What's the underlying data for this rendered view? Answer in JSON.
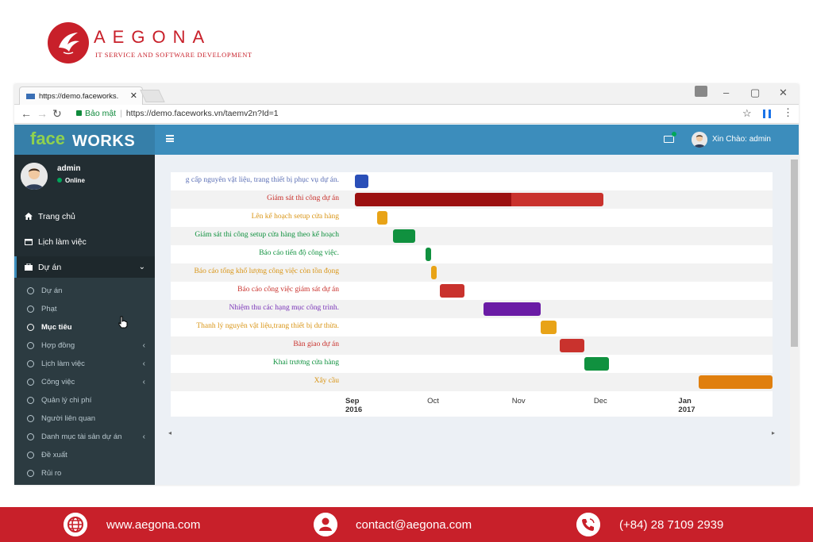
{
  "brand": {
    "name": "AEGONA",
    "tagline": "IT SERVICE AND SOFTWARE DEVELOPMENT"
  },
  "browser": {
    "tab_title": "https://demo.faceworks.",
    "secure_label": "Bảo mật",
    "url": "https://demo.faceworks.vn/taemv2n?Id=1"
  },
  "app": {
    "logo_face": "face",
    "logo_works": "WORKS",
    "user": {
      "name": "admin",
      "status": "Online"
    },
    "greeting": "Xin Chào: admin",
    "menu": [
      {
        "label": "Trang chủ",
        "icon": "home-icon"
      },
      {
        "label": "Lịch làm việc",
        "icon": "calendar-icon"
      },
      {
        "label": "Dự án",
        "icon": "briefcase-icon"
      }
    ],
    "submenu": [
      {
        "label": "Dự án",
        "chevron": false,
        "bold": false
      },
      {
        "label": "Phạt",
        "chevron": false,
        "bold": false
      },
      {
        "label": "Mục tiêu",
        "chevron": false,
        "bold": true
      },
      {
        "label": "Hợp đồng",
        "chevron": true,
        "bold": false
      },
      {
        "label": "Lịch làm việc",
        "chevron": true,
        "bold": false
      },
      {
        "label": "Công việc",
        "chevron": true,
        "bold": false
      },
      {
        "label": "Quản lý chi phí",
        "chevron": false,
        "bold": false
      },
      {
        "label": "Người liên quan",
        "chevron": false,
        "bold": false
      },
      {
        "label": "Danh mục tài sản dự án",
        "chevron": true,
        "bold": false
      },
      {
        "label": "Đề xuất",
        "chevron": false,
        "bold": false
      },
      {
        "label": "Rủi ro",
        "chevron": false,
        "bold": false
      }
    ]
  },
  "gantt": {
    "tasks": [
      {
        "label": "g cấp nguyên vật liệu, trang thiết bị phục vụ dự án.",
        "color": "#2a4fb8",
        "start": "2016-09-01",
        "end": "2016-09-06"
      },
      {
        "label": "Giám sát thi công dự án",
        "color": "#c9322d",
        "done_color": "#9b1010",
        "start": "2016-09-01",
        "end": "2016-12-01",
        "progress": 0.63
      },
      {
        "label": "Lên kế hoạch setup cửa hàng",
        "color": "#e8a317",
        "start": "2016-09-09",
        "end": "2016-09-13"
      },
      {
        "label": "Giám sát thi công setup cửa hàng theo kế hoạch",
        "color": "#10913f",
        "start": "2016-09-15",
        "end": "2016-09-23"
      },
      {
        "label": "Báo cáo tiến độ công việc.",
        "color": "#10913f",
        "start": "2016-09-27",
        "end": "2016-09-29"
      },
      {
        "label": "Báo cáo tổng khổ lượng công việc còn tồn đọng",
        "color": "#e8a317",
        "start": "2016-09-29",
        "end": "2016-10-01"
      },
      {
        "label": "Báo cáo công việc giám sát dự án",
        "color": "#c9322d",
        "start": "2016-10-02",
        "end": "2016-10-11"
      },
      {
        "label": "Nhiệm thu các hạng mục công trình.",
        "color": "#6a1ba5",
        "start": "2016-10-18",
        "end": "2016-11-08"
      },
      {
        "label": "Thanh lý nguyên vật liệu,trang thiết bị dư thừa.",
        "color": "#e8a317",
        "start": "2016-11-08",
        "end": "2016-11-14"
      },
      {
        "label": "Bàn giao dự án",
        "color": "#c9322d",
        "start": "2016-11-15",
        "end": "2016-11-24"
      },
      {
        "label": "Khai trương cửa hàng",
        "color": "#10913f",
        "start": "2016-11-24",
        "end": "2016-12-03"
      },
      {
        "label": "Xây cầu",
        "color": "#e07f0e",
        "start": "2017-01-05",
        "end": "2017-02-01"
      }
    ],
    "ticks": [
      {
        "month": "Sep",
        "year": "2016",
        "date": "2016-09-01"
      },
      {
        "month": "Oct",
        "year": "",
        "date": "2016-10-01"
      },
      {
        "month": "Nov",
        "year": "",
        "date": "2016-11-01"
      },
      {
        "month": "Dec",
        "year": "",
        "date": "2016-12-01"
      },
      {
        "month": "Jan",
        "year": "2017",
        "date": "2017-01-01"
      }
    ],
    "domain": [
      "2016-09-01",
      "2017-02-01"
    ],
    "label_colors": [
      "#5b6fb5",
      "#c9322d",
      "#d99516",
      "#10913f",
      "#10913f",
      "#d99516",
      "#c9322d",
      "#7a34b8",
      "#d99516",
      "#c9322d",
      "#10913f",
      "#d99516"
    ]
  },
  "footer": {
    "website": "www.aegona.com",
    "email": "contact@aegona.com",
    "phone": "(+84) 28 7109 2939",
    "icons": [
      "globe-icon",
      "contact-icon",
      "phone-icon"
    ]
  }
}
